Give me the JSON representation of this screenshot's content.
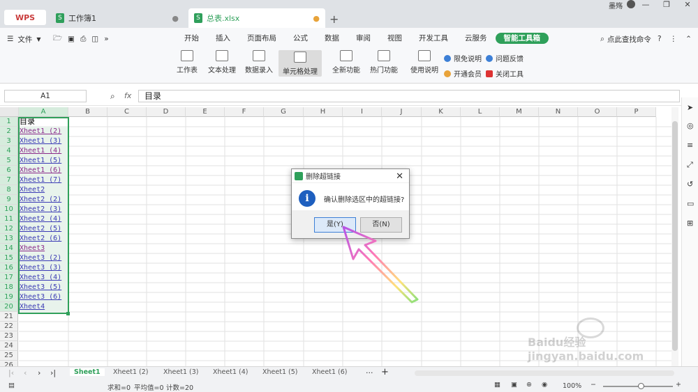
{
  "tabs": {
    "wps": "WPS",
    "book1": "工作簿1",
    "active_file": "总表.xlsx",
    "user": "墨殇"
  },
  "menu": {
    "file": "文件"
  },
  "ribbon_tabs": [
    "开始",
    "插入",
    "页面布局",
    "公式",
    "数据",
    "审阅",
    "视图",
    "开发工具",
    "云服务",
    "智能工具箱"
  ],
  "search_cmd": "点此查找命令",
  "tools": {
    "worksheet": "工作表",
    "text": "文本处理",
    "data_entry": "数据录入",
    "cell_proc": "单元格处理",
    "all_func": "全新功能",
    "hot_func": "热门功能",
    "usage": "使用说明",
    "free_desc": "限免说明",
    "feedback": "问题反馈",
    "vip": "开通会员",
    "close_tool": "关闭工具"
  },
  "formula_bar": {
    "name_box": "A1",
    "fx": "fx",
    "content": "目录"
  },
  "columns": [
    "A",
    "B",
    "C",
    "D",
    "E",
    "F",
    "G",
    "H",
    "I",
    "J",
    "K",
    "L",
    "M",
    "N",
    "O",
    "P"
  ],
  "cells_a": [
    {
      "text": "目录",
      "style": "plain"
    },
    {
      "text": "Xheet1 (2)",
      "style": "visited"
    },
    {
      "text": "Xheet1 (3)",
      "style": "link"
    },
    {
      "text": "Xheet1 (4)",
      "style": "visited"
    },
    {
      "text": "Xheet1 (5)",
      "style": "link"
    },
    {
      "text": "Xheet1 (6)",
      "style": "visited"
    },
    {
      "text": "Xheet1 (7)",
      "style": "link"
    },
    {
      "text": "Xheet2",
      "style": "link"
    },
    {
      "text": "Xheet2 (2)",
      "style": "link"
    },
    {
      "text": "Xheet2 (3)",
      "style": "link"
    },
    {
      "text": "Xheet2 (4)",
      "style": "link"
    },
    {
      "text": "Xheet2 (5)",
      "style": "link"
    },
    {
      "text": "Xheet2 (6)",
      "style": "link"
    },
    {
      "text": "Xheet3",
      "style": "visited"
    },
    {
      "text": "Xheet3 (2)",
      "style": "link"
    },
    {
      "text": "Xheet3 (3)",
      "style": "link"
    },
    {
      "text": "Xheet3 (4)",
      "style": "link"
    },
    {
      "text": "Xheet3 (5)",
      "style": "link"
    },
    {
      "text": "Xheet3 (6)",
      "style": "link"
    },
    {
      "text": "Xheet4",
      "style": "link"
    }
  ],
  "sheet_tabs": [
    "Sheet1",
    "Xheet1 (2)",
    "Xheet1 (3)",
    "Xheet1 (4)",
    "Xheet1 (5)",
    "Xheet1 (6)"
  ],
  "status": {
    "sum": "求和=0",
    "avg": "平均值=0",
    "count": "计数=20",
    "zoom": "100%"
  },
  "dialog": {
    "title": "删除超链接",
    "message": "确认删除选区中的超链接?",
    "yes": "是(Y)",
    "no": "否(N)"
  },
  "watermark": "Baidu经验 jingyan.baidu.com"
}
